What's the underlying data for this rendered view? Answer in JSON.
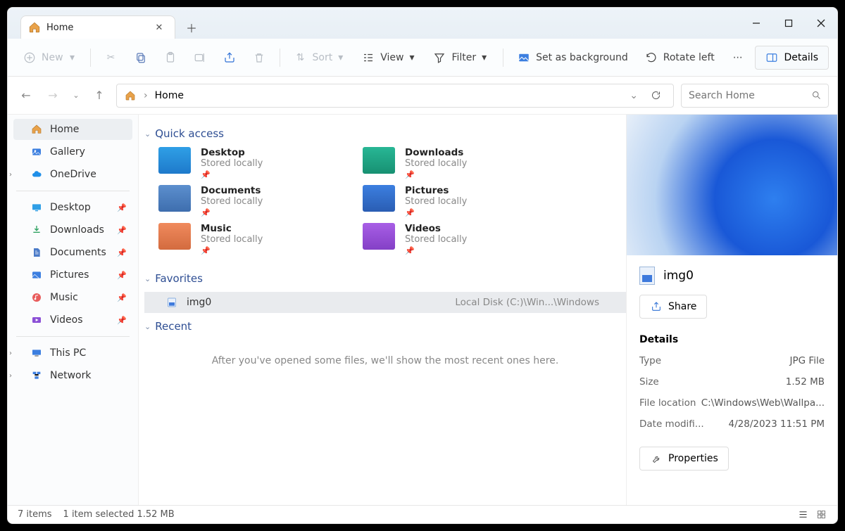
{
  "titlebar": {
    "tab_label": "Home"
  },
  "toolbar": {
    "new": "New",
    "sort": "Sort",
    "view": "View",
    "filter": "Filter",
    "set_bg": "Set as background",
    "rotate": "Rotate left",
    "details": "Details"
  },
  "addr": {
    "location": "Home",
    "search_placeholder": "Search Home"
  },
  "sidebar": {
    "home": "Home",
    "gallery": "Gallery",
    "onedrive": "OneDrive",
    "desktop": "Desktop",
    "downloads": "Downloads",
    "documents": "Documents",
    "pictures": "Pictures",
    "music": "Music",
    "videos": "Videos",
    "thispc": "This PC",
    "network": "Network"
  },
  "main": {
    "quick_access": "Quick access",
    "favorites": "Favorites",
    "recent": "Recent",
    "recent_empty": "After you've opened some files, we'll show the most recent ones here.",
    "stored": "Stored locally",
    "qa": {
      "desktop": "Desktop",
      "downloads": "Downloads",
      "documents": "Documents",
      "pictures": "Pictures",
      "music": "Music",
      "videos": "Videos"
    },
    "fav_item": "img0",
    "fav_path": "Local Disk (C:)\\Win...\\Windows"
  },
  "preview": {
    "filename": "img0",
    "share": "Share",
    "details": "Details",
    "properties": "Properties",
    "rows": {
      "type_k": "Type",
      "type_v": "JPG File",
      "size_k": "Size",
      "size_v": "1.52 MB",
      "loc_k": "File location",
      "loc_v": "C:\\Windows\\Web\\Wallpa...",
      "mod_k": "Date modifi...",
      "mod_v": "4/28/2023 11:51 PM"
    }
  },
  "status": {
    "items": "7 items",
    "selected": "1 item selected  1.52 MB"
  }
}
